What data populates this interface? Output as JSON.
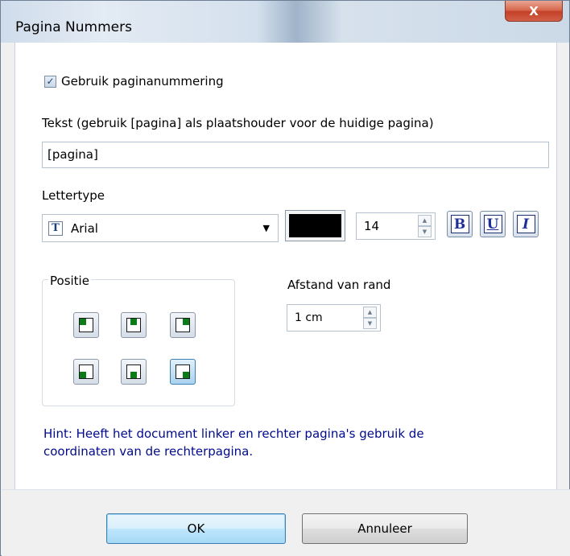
{
  "window": {
    "title": "Pagina Nummers",
    "close_label": "X"
  },
  "options": {
    "use_numbering_label": "Gebruik paginanummering",
    "use_numbering_checked": true,
    "text_label": "Tekst (gebruik [pagina] als plaatshouder voor de huidige pagina)",
    "text_value": "[pagina]"
  },
  "font": {
    "label": "Lettertype",
    "font_name": "Arial",
    "color": "#000000",
    "size": "14",
    "bold_label": "B",
    "underline_label": "U",
    "italic_label": "I"
  },
  "position": {
    "legend": "Positie",
    "buttons": [
      {
        "name": "top-left",
        "active": false
      },
      {
        "name": "top-center",
        "active": false
      },
      {
        "name": "top-right",
        "active": false
      },
      {
        "name": "bottom-left",
        "active": false
      },
      {
        "name": "bottom-center",
        "active": false
      },
      {
        "name": "bottom-right",
        "active": true
      }
    ]
  },
  "margin": {
    "label": "Afstand van rand",
    "value": "1 cm"
  },
  "hint": "Hint: Heeft het document linker en rechter pagina's gebruik de coordinaten van de rechterpagina.",
  "footer": {
    "ok_label": "OK",
    "cancel_label": "Annuleer"
  }
}
